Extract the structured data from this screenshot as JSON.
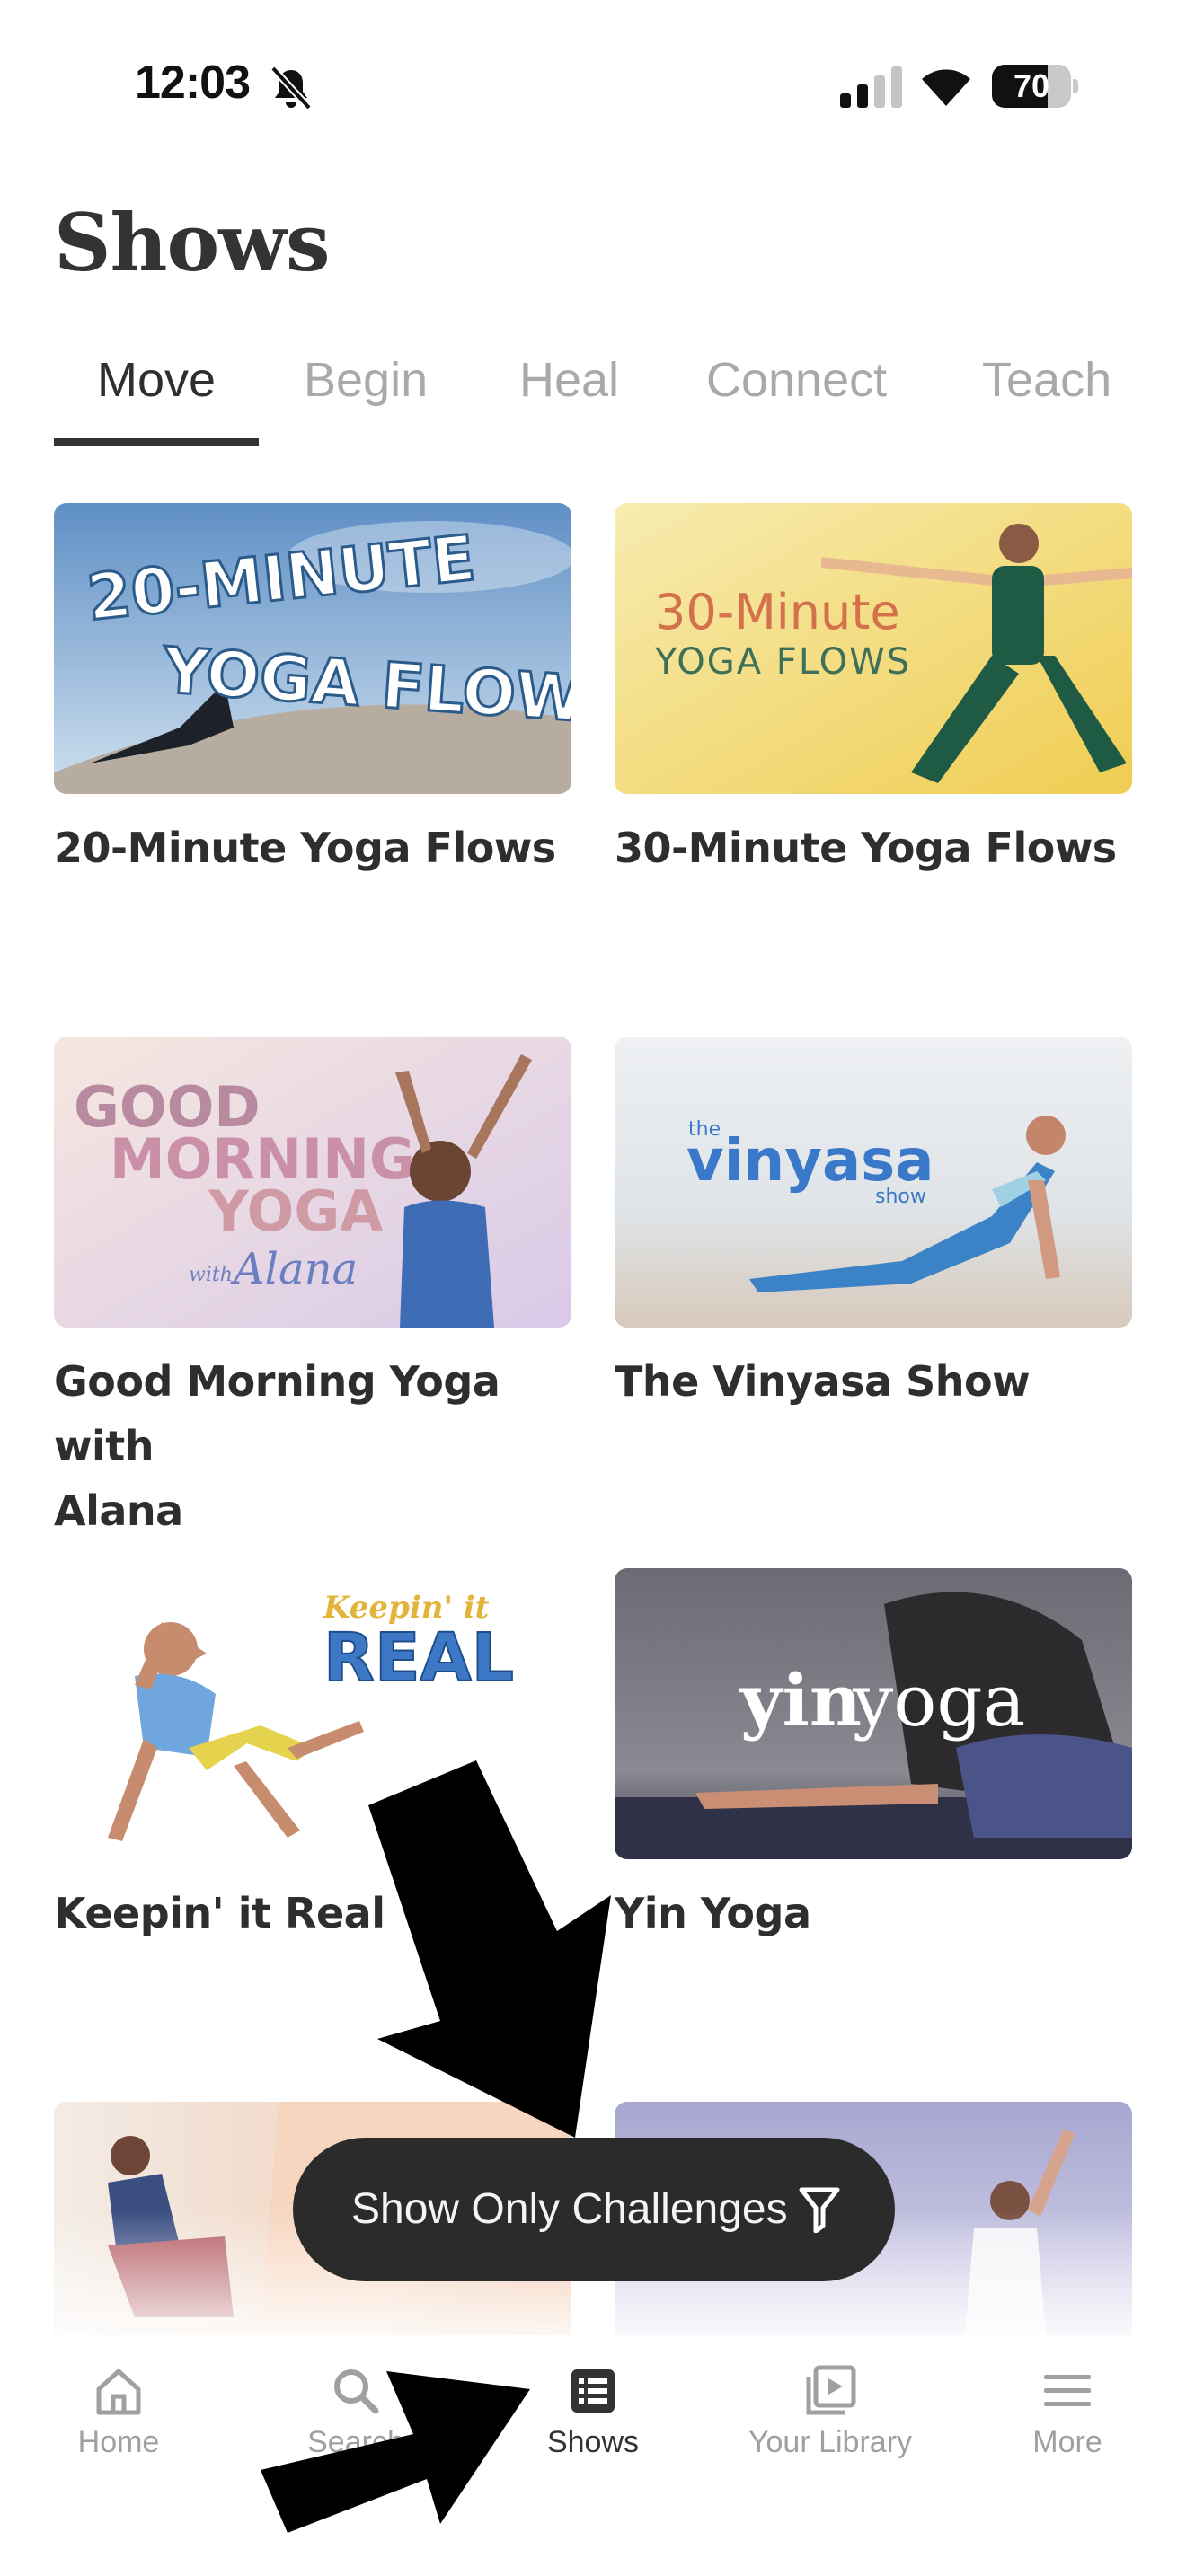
{
  "status_bar": {
    "time": "12:03",
    "battery_level": 70,
    "battery_text": "70"
  },
  "page": {
    "title": "Shows"
  },
  "tabs": [
    {
      "label": "Move",
      "active": true
    },
    {
      "label": "Begin",
      "active": false
    },
    {
      "label": "Heal",
      "active": false
    },
    {
      "label": "Connect",
      "active": false
    },
    {
      "label": "Teach",
      "active": false
    }
  ],
  "shows": [
    {
      "title": "20-Minute Yoga Flows",
      "art_text": [
        "20-MINUTE",
        "YOGA FLOWS"
      ]
    },
    {
      "title": "30-Minute Yoga Flows",
      "art_text": [
        "30-Minute",
        "YOGA FLOWS"
      ]
    },
    {
      "title_line1": "Good Morning Yoga with",
      "title_line2": "Alana",
      "art_text": [
        "GOOD",
        "MORNING",
        "YOGA",
        "with",
        "Alana"
      ]
    },
    {
      "title": "The Vinyasa Show",
      "art_text": [
        "the",
        "vinyasa",
        "show"
      ]
    },
    {
      "title": "Keepin' it Real",
      "art_text": [
        "Keepin' it",
        "REAL"
      ]
    },
    {
      "title": "Yin Yoga",
      "art_text": [
        "yin",
        "yoga"
      ]
    }
  ],
  "filter_pill": {
    "label": "Show Only Challenges",
    "icon": "filter-icon"
  },
  "tab_bar": [
    {
      "label": "Home",
      "icon": "home-icon",
      "active": false
    },
    {
      "label": "Search",
      "icon": "search-icon",
      "active": false
    },
    {
      "label": "Shows",
      "icon": "shows-icon",
      "active": true
    },
    {
      "label": "Your Library",
      "icon": "library-icon",
      "active": false
    },
    {
      "label": "More",
      "icon": "menu-icon",
      "active": false
    }
  ],
  "colors": {
    "text_dark": "#2e2e2e",
    "text_muted": "#a9a9a9",
    "pill_bg": "#2b2b2b",
    "arrow": "#000000"
  }
}
